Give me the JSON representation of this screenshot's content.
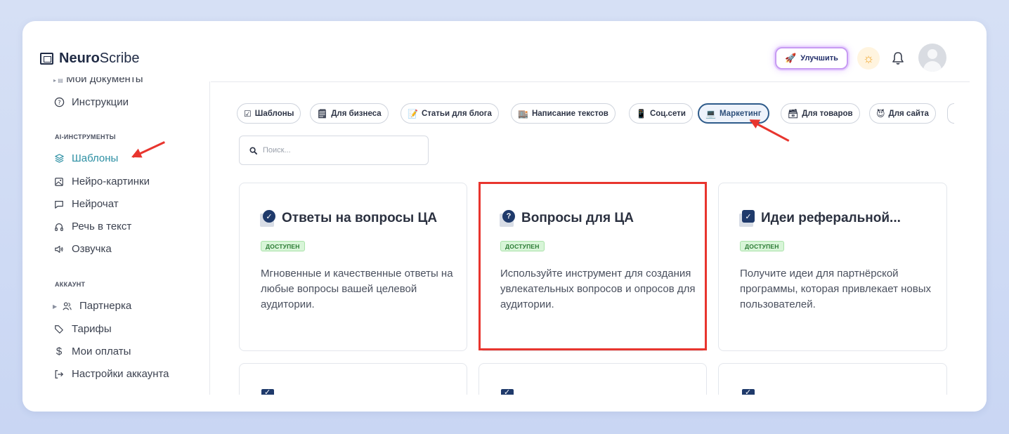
{
  "header": {
    "logo_bold": "Neuro",
    "logo_light": "Scribe",
    "upgrade_label": "Улучшить"
  },
  "sidebar": {
    "cut_item": "Мои документы",
    "instructions": "Инструкции",
    "section_ai": "AI-ИНСТРУМЕНТЫ",
    "ai_items": [
      {
        "label": "Шаблоны",
        "icon": "layers-icon",
        "active": true
      },
      {
        "label": "Нейро-картинки",
        "icon": "image-icon"
      },
      {
        "label": "Нейрочат",
        "icon": "chat-icon"
      },
      {
        "label": "Речь в текст",
        "icon": "headphones-icon"
      },
      {
        "label": "Озвучка",
        "icon": "speaker-icon"
      }
    ],
    "section_account": "АККАУНТ",
    "account_items": [
      {
        "label": "Партнерка",
        "icon": "users-icon"
      },
      {
        "label": "Тарифы",
        "icon": "tag-icon"
      },
      {
        "label": "Мои оплаты",
        "icon": "dollar-icon"
      },
      {
        "label": "Настройки аккаунта",
        "icon": "login-icon"
      }
    ]
  },
  "categories": [
    {
      "emoji": "☑",
      "label": "Шаблоны"
    },
    {
      "emoji": "🗒",
      "label": "Для бизнеса"
    },
    {
      "emoji": "📝",
      "label": "Статьи для блога"
    },
    {
      "emoji": "🏬",
      "label": "Написание текстов"
    },
    {
      "emoji": "📱",
      "label": "Соц.сети"
    },
    {
      "emoji": "💻",
      "label": "Маркетинг",
      "active": true
    },
    {
      "emoji": "🗃",
      "label": "Для товаров"
    },
    {
      "emoji": "😈",
      "label": "Для сайта"
    }
  ],
  "search": {
    "placeholder": "Поиск..."
  },
  "cards": [
    {
      "title": "Ответы на вопросы ЦА",
      "badge": "ДОСТУПЕН",
      "icon": "check-circle-icon",
      "description": "Мгновенные и качественные ответы на любые вопросы вашей целевой аудитории."
    },
    {
      "title": "Вопросы для ЦА",
      "badge": "ДОСТУПЕН",
      "icon": "question-circle-icon",
      "description": "Используйте инструмент для создания увлекательных вопросов и опросов для аудитории."
    },
    {
      "title": "Идеи реферальной...",
      "badge": "ДОСТУПЕН",
      "icon": "checkbox-icon",
      "description": "Получите идеи для партнёрской программы, которая привлекает новых пользователей."
    }
  ],
  "colors": {
    "accent": "#2c8fa3",
    "annotation": "#e8352e",
    "badge_bg": "#d8f5d8"
  }
}
